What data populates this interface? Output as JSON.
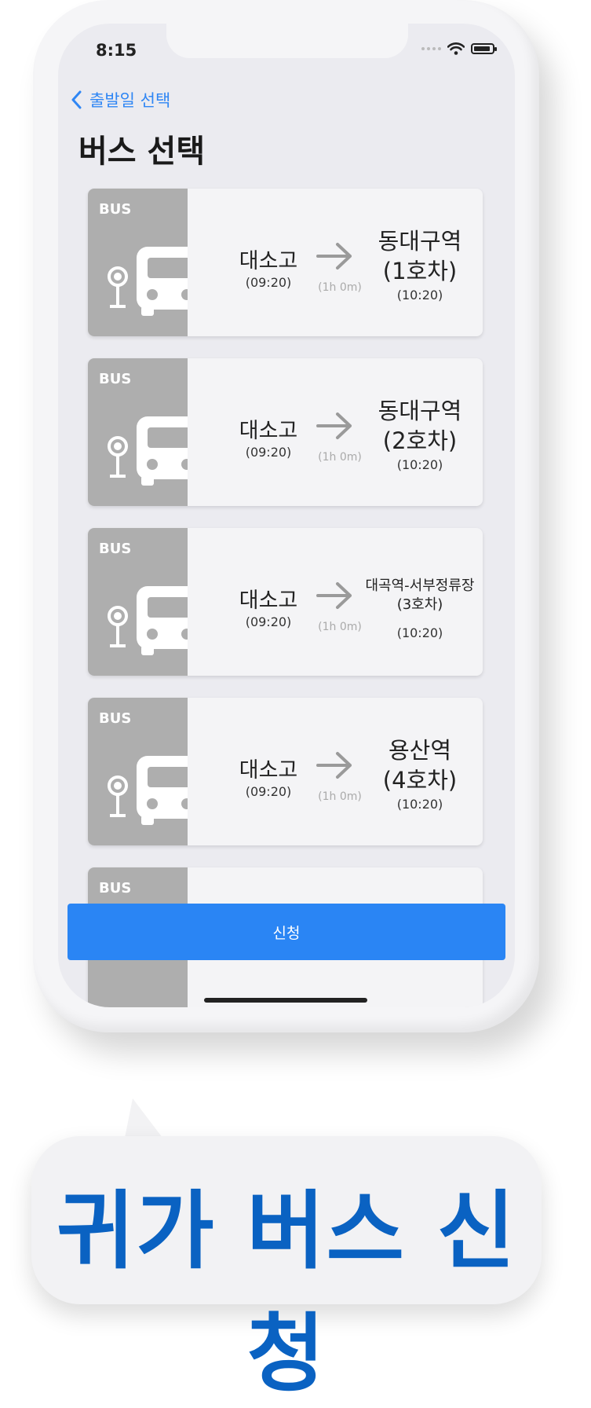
{
  "status_bar": {
    "time": "8:15"
  },
  "nav": {
    "back_label": "출발일 선택",
    "title": "버스 선택"
  },
  "bus_cards": [
    {
      "tag": "BUS",
      "from": "대소고",
      "from_time": "(09:20)",
      "duration": "(1h 0m)",
      "to": "동대구역",
      "car": "(1호차)",
      "to_time": "(10:20)"
    },
    {
      "tag": "BUS",
      "from": "대소고",
      "from_time": "(09:20)",
      "duration": "(1h 0m)",
      "to": "동대구역",
      "car": "(2호차)",
      "to_time": "(10:20)"
    },
    {
      "tag": "BUS",
      "from": "대소고",
      "from_time": "(09:20)",
      "duration": "(1h 0m)",
      "to": "대곡역-서부정류장",
      "car": "(3호차)",
      "to_time": "(10:20)"
    },
    {
      "tag": "BUS",
      "from": "대소고",
      "from_time": "(09:20)",
      "duration": "(1h 0m)",
      "to": "용산역",
      "car": "(4호차)",
      "to_time": "(10:20)"
    },
    {
      "tag": "BUS"
    }
  ],
  "apply_button": {
    "label": "신청"
  },
  "caption": {
    "text": "귀가 버스 신청"
  },
  "colors": {
    "accent": "#2a85f4",
    "caption": "#0a62c2",
    "card_side": "#aeaeae"
  }
}
